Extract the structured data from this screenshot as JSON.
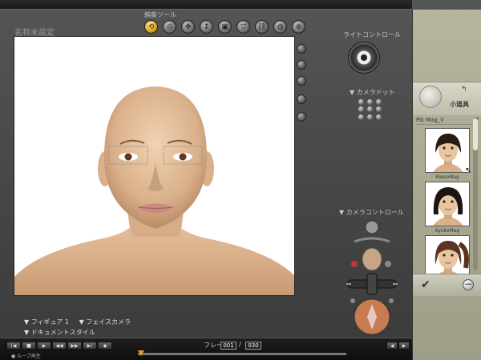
{
  "app": {
    "document_title": "名称未設定"
  },
  "toolbar": {
    "title": "編集ツール",
    "tools": [
      {
        "name": "rotate-tool",
        "glyph": "⟲",
        "active": true
      },
      {
        "name": "twist-tool",
        "glyph": "◎"
      },
      {
        "name": "translate-tool",
        "glyph": "✥"
      },
      {
        "name": "translate-in-out-tool",
        "glyph": "↕"
      },
      {
        "name": "scale-tool",
        "glyph": "▣"
      },
      {
        "name": "taper-tool",
        "glyph": "▽"
      },
      {
        "name": "chain-break-tool",
        "glyph": "⛓"
      },
      {
        "name": "color-tool",
        "glyph": "◍"
      },
      {
        "name": "view-magnifier-tool",
        "glyph": "⊕"
      }
    ]
  },
  "controls": {
    "light_label": "ライトコントロール",
    "camera_dot_label": "▼ カメラドット",
    "camera_control_label": "▼ カメラコントロール"
  },
  "bottom": {
    "tab_figure": "▼ フィギュア 1",
    "tab_face_camera": "▼ フェイスカメラ",
    "doc_style": "▼ ドキュメントスタイル"
  },
  "timeline": {
    "frame_label": "フレーム：",
    "current_frame": "001",
    "total_frames": "030",
    "loop_label": "● ループ再生"
  },
  "library": {
    "section_title": "小道具",
    "selected_library": "PG Mag_V",
    "items": [
      {
        "label": "RieeoMag",
        "hair": "#2a1a14",
        "style": "short"
      },
      {
        "label": "KyokoMag",
        "hair": "#1c1410",
        "style": "bob"
      },
      {
        "label": "",
        "hair": "#5a3420",
        "style": "tied"
      }
    ]
  },
  "colors": {
    "accent": "#d49a10",
    "panel": "#b7b59c",
    "skin": "#e8c4a0"
  }
}
